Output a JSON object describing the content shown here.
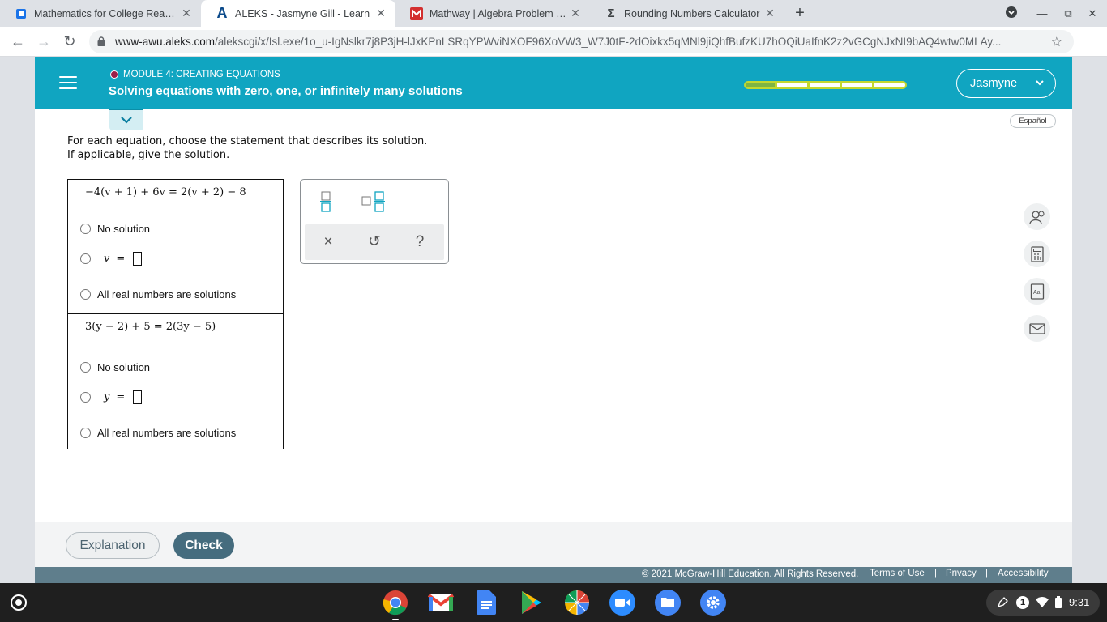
{
  "browser": {
    "tabs": [
      {
        "title": "Mathematics for College Readine",
        "favicon": "book-icon",
        "active": false
      },
      {
        "title": "ALEKS - Jasmyne Gill - Learn",
        "favicon": "aleks-logo-icon",
        "active": true
      },
      {
        "title": "Mathway | Algebra Problem Solv",
        "favicon": "mathway-logo-icon",
        "active": false
      },
      {
        "title": "Rounding Numbers Calculator",
        "favicon": "sigma-icon",
        "active": false
      }
    ],
    "url_host": "www-awu.aleks.com",
    "url_path": "/alekscgi/x/Isl.exe/1o_u-IgNslkr7j8P3jH-lJxKPnLSRqYPWviNXOF96XoVW3_W7J0tF-2dOixkx5qMNl9jiQhfBufzKU7hOQiUaIfnK2z2vGCgNJxNI9bAQ4wtw0MLAy..."
  },
  "header": {
    "module": "MODULE 4: CREATING EQUATIONS",
    "topic": "Solving equations with zero, one, or infinitely many solutions",
    "progress_fraction": 0.2,
    "user_name": "Jasmyne",
    "brand_color": "#10a5c1"
  },
  "espanol": "Español",
  "instructions": {
    "line1": "For each equation, choose the statement that describes its solution.",
    "line2": "If applicable, give the solution."
  },
  "problems": [
    {
      "equation": "−4(v + 1) + 6v = 2(v + 2) − 8",
      "variable": "v",
      "options": {
        "no_solution": "No solution",
        "equals": "=",
        "all_real": "All real numbers are solutions"
      }
    },
    {
      "equation": "3(y − 2) + 5 = 2(3y − 5)",
      "variable": "y",
      "options": {
        "no_solution": "No solution",
        "equals": "=",
        "all_real": "All real numbers are solutions"
      }
    }
  ],
  "palette": {
    "keys": [
      "fraction-icon",
      "mixed-number-icon"
    ],
    "actions": {
      "clear": "×",
      "undo": "↺",
      "help": "?"
    }
  },
  "tools": [
    "ask-instructor-icon",
    "calculator-icon",
    "dictionary-icon",
    "message-icon"
  ],
  "footer": {
    "explanation": "Explanation",
    "check": "Check",
    "copyright": "© 2021 McGraw-Hill Education. All Rights Reserved.",
    "terms": "Terms of Use",
    "privacy": "Privacy",
    "accessibility": "Accessibility",
    "separator": "|"
  },
  "shelf": {
    "apps": [
      "chrome-icon",
      "gmail-icon",
      "docs-icon",
      "play-store-icon",
      "canvas-icon",
      "zoom-icon",
      "files-icon",
      "settings-icon"
    ],
    "notification_count": "1",
    "time": "9:31"
  }
}
